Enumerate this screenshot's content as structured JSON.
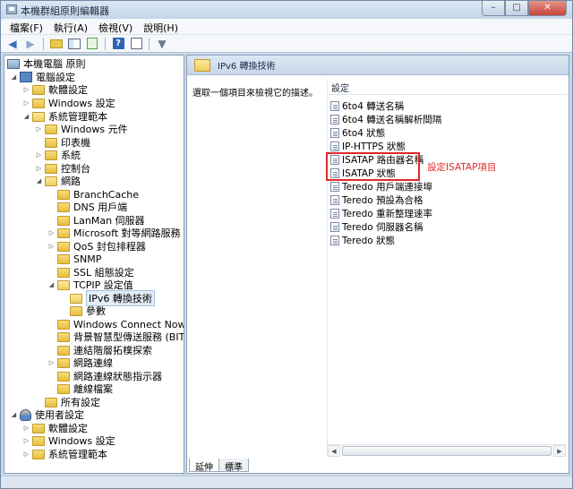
{
  "window": {
    "title": "本機群組原則編輯器",
    "buttons": {
      "minimize": "–",
      "maximize": "□",
      "close": "✕"
    }
  },
  "menubar": [
    "檔案(F)",
    "執行(A)",
    "檢視(V)",
    "說明(H)"
  ],
  "tree": {
    "root": "本機電腦 原則",
    "computer": "電腦設定",
    "items": [
      "軟體設定",
      "Windows 設定",
      "系統管理範本",
      "Windows 元件",
      "印表機",
      "系統",
      "控制台",
      "網路",
      "BranchCache",
      "DNS 用戶端",
      "LanMan 伺服器",
      "Microsoft 對等網路服務",
      "QoS 封包排程器",
      "SNMP",
      "SSL 組態設定",
      "TCPIP 設定值",
      "IPv6 轉換技術",
      "參數",
      "Windows Connect Now",
      "背景智慧型傳送服務 (BITS)",
      "連結階層拓樸探索",
      "網路連線",
      "網路連線狀態指示器",
      "離線檔案",
      "所有設定"
    ],
    "user": "使用者設定",
    "user_items": [
      "軟體設定",
      "Windows 設定",
      "系統管理範本"
    ]
  },
  "right_pane": {
    "header_title": "IPv6 轉換技術",
    "description": "選取一個項目來檢視它的描述。",
    "column_header": "設定",
    "settings": [
      "6to4 轉送名稱",
      "6to4 轉送名稱解析間隔",
      "6to4 狀態",
      "IP-HTTPS 狀態",
      "ISATAP 路由器名稱",
      "ISATAP 狀態",
      "Teredo 用戶端連接埠",
      "Teredo 預設為合格",
      "Teredo 重新整理速率",
      "Teredo 伺服器名稱",
      "Teredo 狀態"
    ],
    "annotation": "設定ISATAP項目",
    "tabs": [
      "延伸",
      "標準"
    ]
  },
  "colors": {
    "annotation": "#e0282a",
    "title_bg": "#c9daea"
  }
}
